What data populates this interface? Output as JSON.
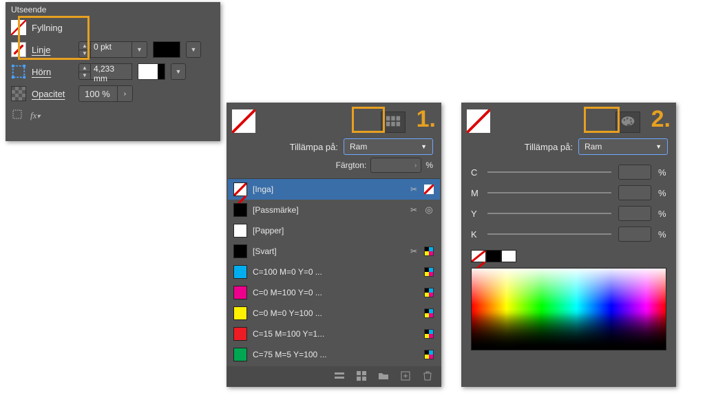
{
  "appearance": {
    "title": "Utseende",
    "fill_label": "Fyllning",
    "stroke_label": "Linje",
    "stroke_value": "0 pkt",
    "corner_label": "Hörn",
    "corner_value": "4,233 mm",
    "opacity_label": "Opacitet",
    "opacity_value": "100 %"
  },
  "swatches_panel": {
    "step_number": "1.",
    "apply_label": "Tillämpa på:",
    "apply_value": "Ram",
    "tint_label": "Färgton:",
    "tint_unit": "%",
    "items": [
      {
        "name": "[Inga]",
        "chip": "chip-none",
        "glyph1": "cut",
        "glyph2": "none",
        "selected": true
      },
      {
        "name": "[Passmärke]",
        "chip": "chip-reg",
        "glyph1": "cut",
        "glyph2": "target",
        "selected": false
      },
      {
        "name": "[Papper]",
        "chip": "chip-paper",
        "glyph1": "",
        "glyph2": "",
        "selected": false
      },
      {
        "name": "[Svart]",
        "chip": "chip-svart",
        "glyph1": "cut",
        "glyph2": "cmyk",
        "selected": false
      },
      {
        "name": "C=100 M=0 Y=0 ...",
        "chip": "chip-c100",
        "glyph1": "",
        "glyph2": "cmyk",
        "selected": false
      },
      {
        "name": "C=0 M=100 Y=0 ...",
        "chip": "chip-m100",
        "glyph1": "",
        "glyph2": "cmyk",
        "selected": false
      },
      {
        "name": "C=0 M=0 Y=100 ...",
        "chip": "chip-y100",
        "glyph1": "",
        "glyph2": "cmyk",
        "selected": false
      },
      {
        "name": "C=15 M=100 Y=1...",
        "chip": "chip-cm",
        "glyph1": "",
        "glyph2": "cmyk",
        "selected": false
      },
      {
        "name": "C=75 M=5 Y=100 ...",
        "chip": "chip-g",
        "glyph1": "",
        "glyph2": "cmyk",
        "selected": false
      }
    ]
  },
  "color_panel": {
    "step_number": "2.",
    "apply_label": "Tillämpa på:",
    "apply_value": "Ram",
    "channels": [
      {
        "letter": "C",
        "pct": "%"
      },
      {
        "letter": "M",
        "pct": "%"
      },
      {
        "letter": "Y",
        "pct": "%"
      },
      {
        "letter": "K",
        "pct": "%"
      }
    ]
  }
}
